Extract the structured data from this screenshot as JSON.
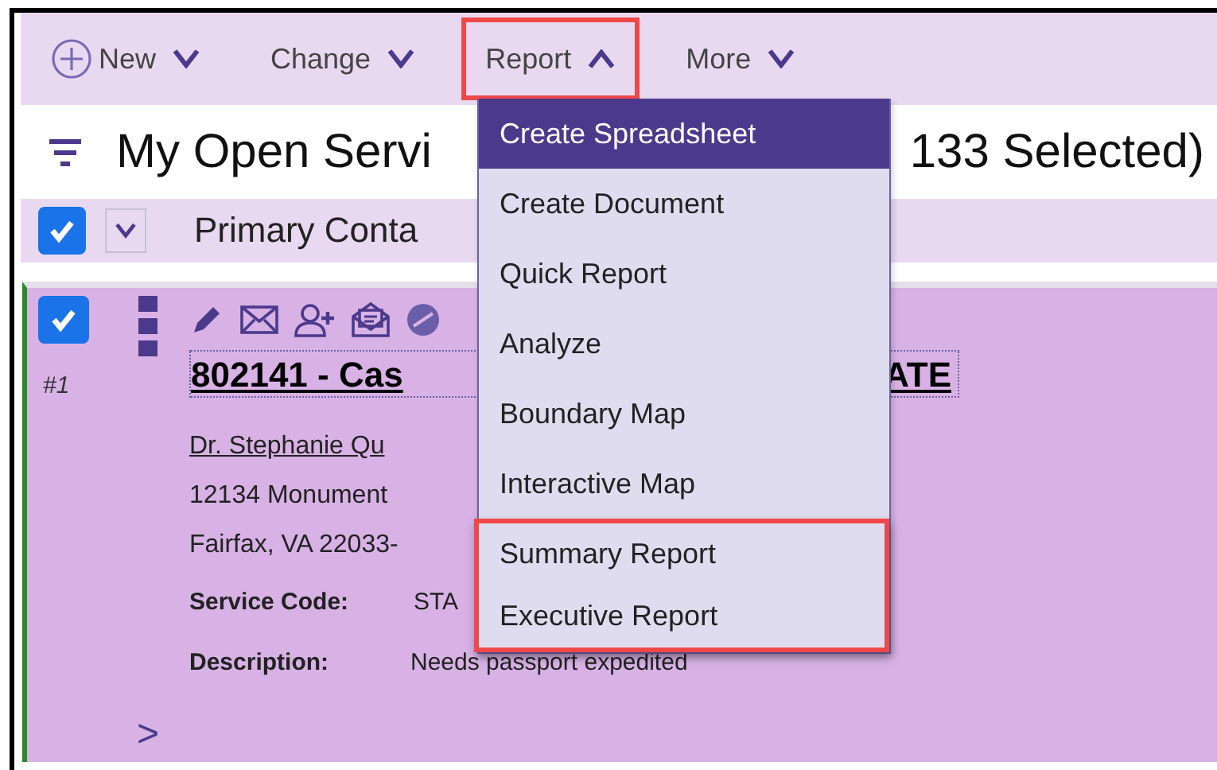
{
  "toolbar": [
    {
      "label": "New",
      "expanded": false,
      "outlined": false
    },
    {
      "label": "Change",
      "expanded": false,
      "outlined": false
    },
    {
      "label": "Report",
      "expanded": true,
      "outlined": true
    },
    {
      "label": "More",
      "expanded": false,
      "outlined": false
    }
  ],
  "list_title": {
    "start": "My Open Servi",
    "end": "133 Selected)"
  },
  "header": {
    "checked": true,
    "column": "Primary Conta"
  },
  "menu": {
    "items": [
      {
        "label": "Create Spreadsheet",
        "selected": true,
        "outlined": false
      },
      {
        "label": "Create Document",
        "selected": false,
        "outlined": false
      },
      {
        "label": "Quick Report",
        "selected": false,
        "outlined": false
      },
      {
        "label": "Analyze",
        "selected": false,
        "outlined": false
      },
      {
        "label": "Boundary Map",
        "selected": false,
        "outlined": false
      },
      {
        "label": "Interactive Map",
        "selected": false,
        "outlined": false
      },
      {
        "label": "Summary Report",
        "selected": false,
        "outlined": true
      },
      {
        "label": "Executive Report",
        "selected": false,
        "outlined": true
      }
    ]
  },
  "records": [
    {
      "checked": true,
      "number": "#1",
      "title_start": "802141 - Cas",
      "title_end": "ATE",
      "contact": "Dr. Stephanie Qu",
      "address_lines": [
        "12134 Monument",
        "Fairfax, VA 22033-"
      ],
      "fields": [
        {
          "label": "Service Code:",
          "value": "STA"
        },
        {
          "label": "Description:",
          "value": "Needs passport expedited"
        }
      ]
    }
  ],
  "expand_arrow": ">"
}
